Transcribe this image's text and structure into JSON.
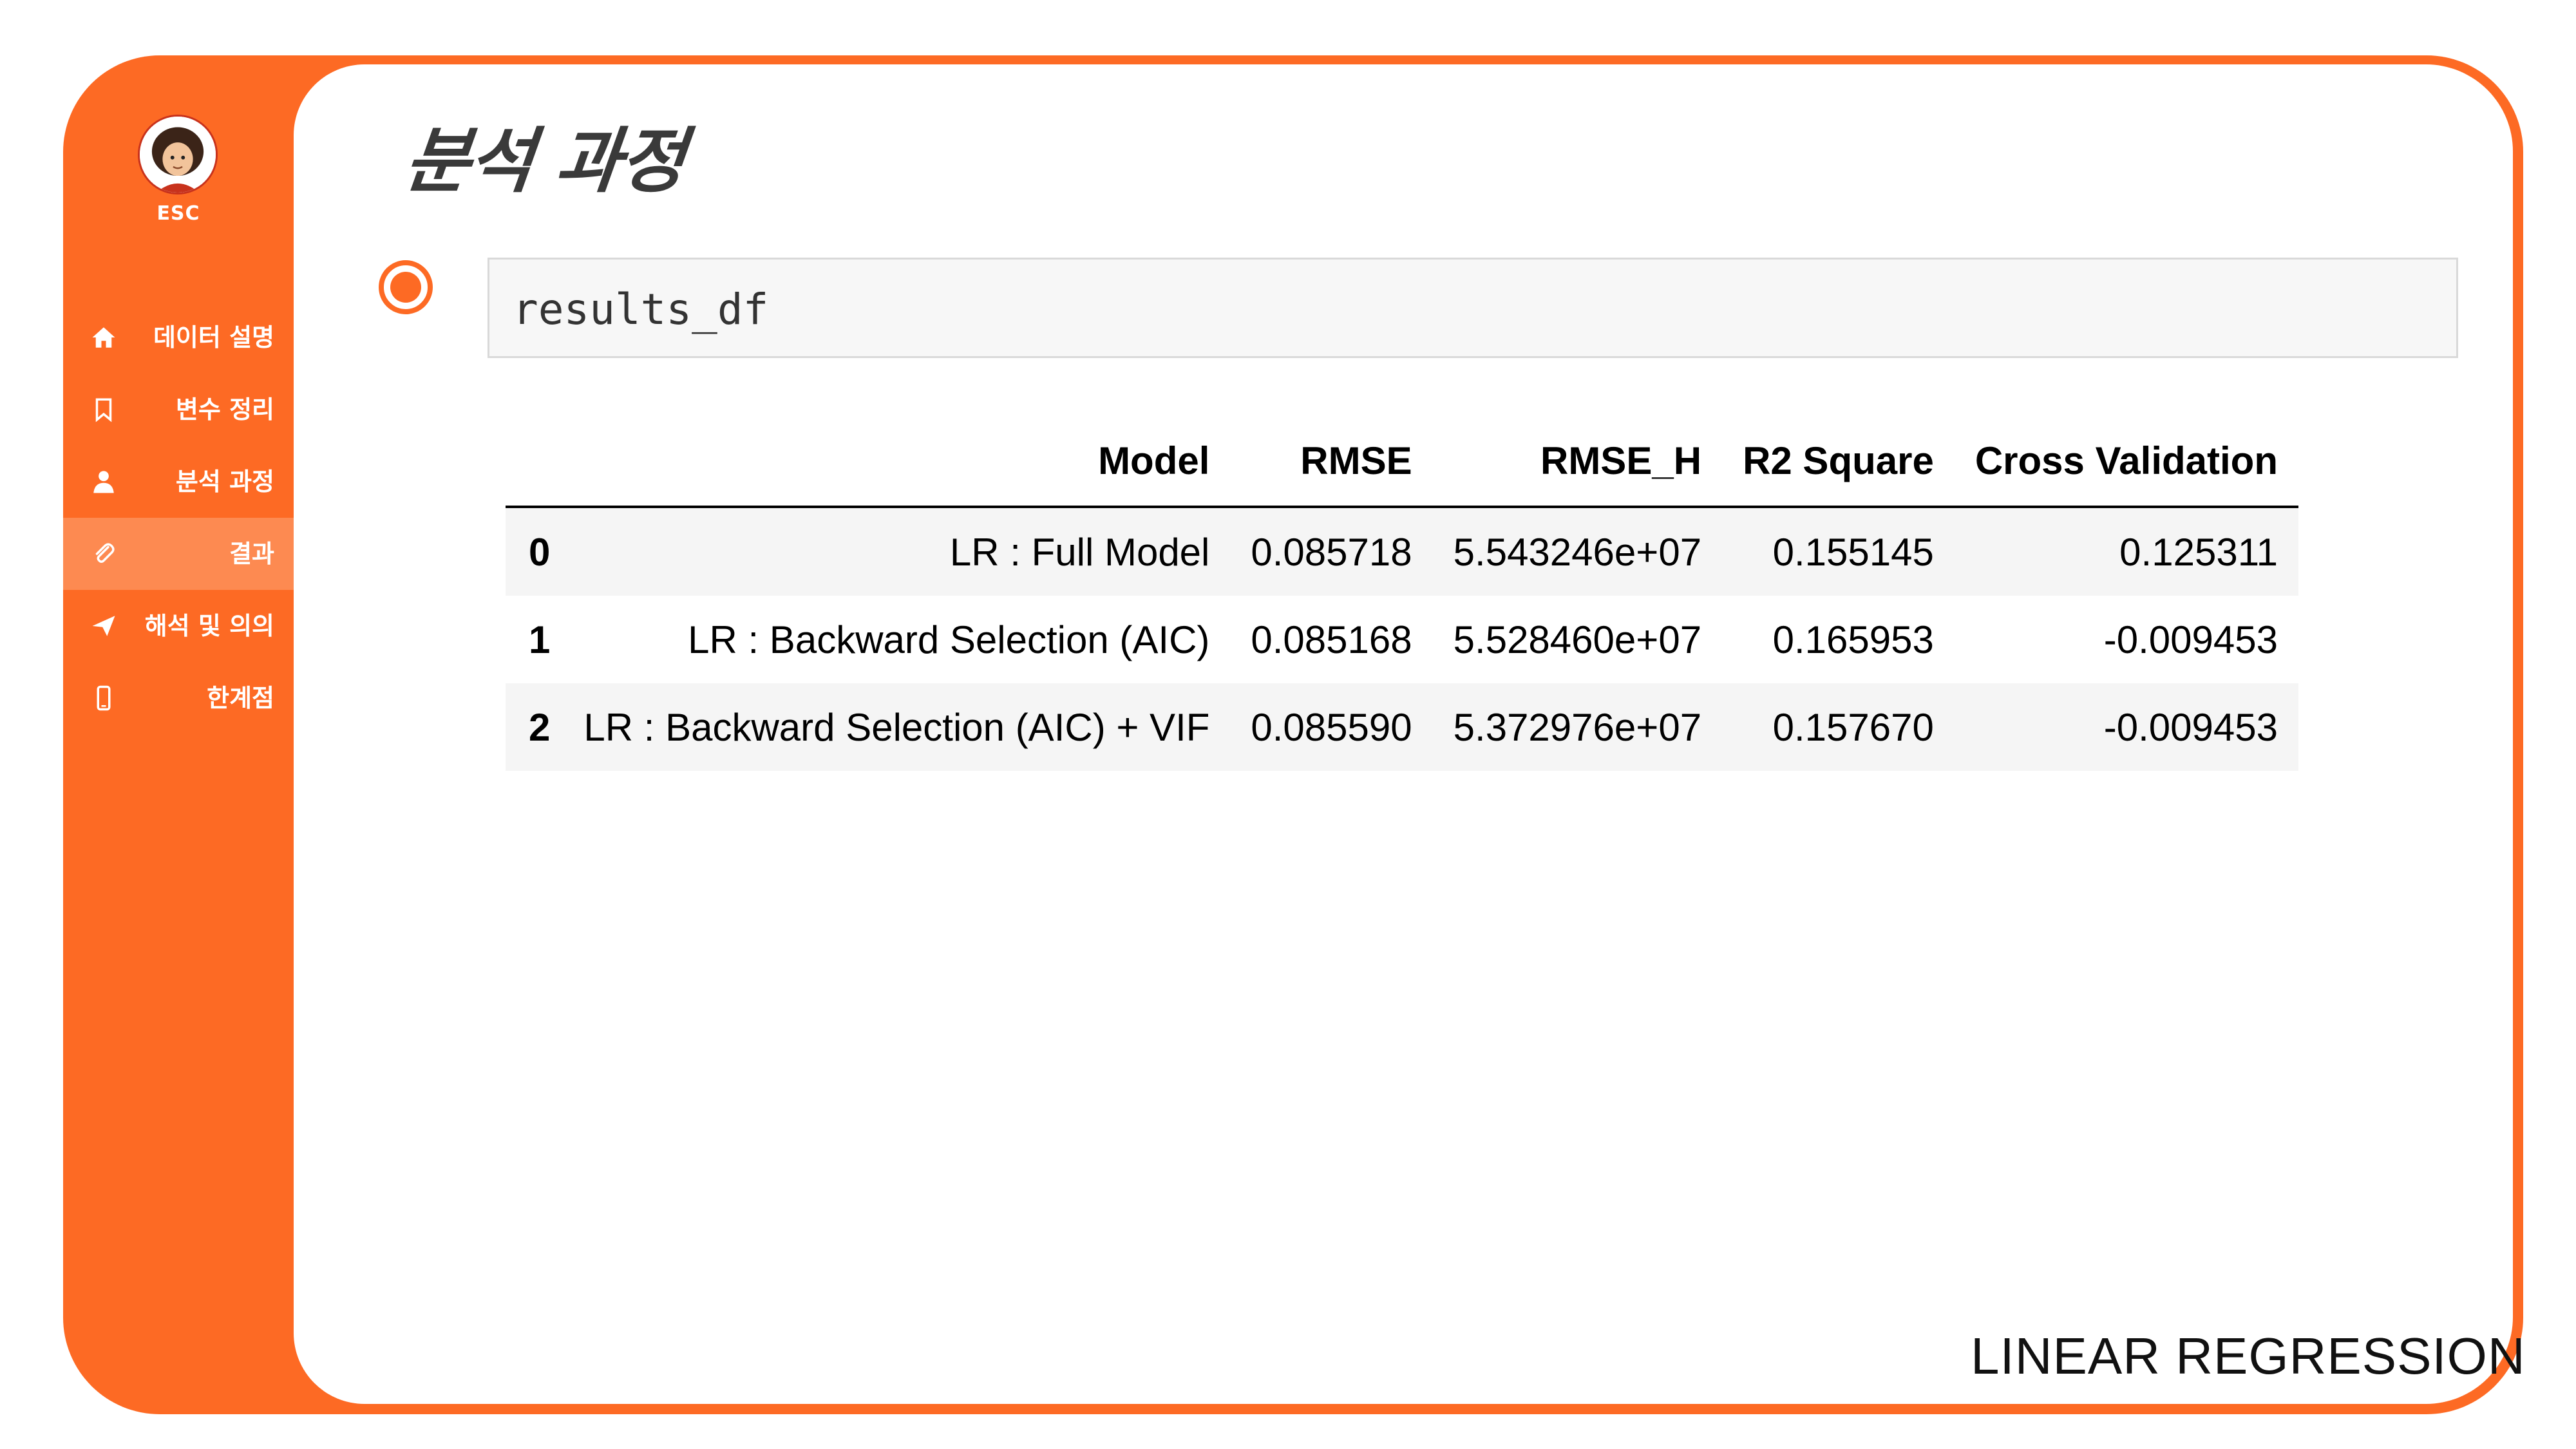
{
  "sidebar": {
    "logo_text": "ESC",
    "items": [
      {
        "label": "데이터 설명",
        "icon": "home-icon"
      },
      {
        "label": "변수 정리",
        "icon": "bookmark-icon"
      },
      {
        "label": "분석 과정",
        "icon": "user-icon"
      },
      {
        "label": "결과",
        "icon": "paperclip-icon",
        "active": true
      },
      {
        "label": "해석 및 의의",
        "icon": "send-icon"
      },
      {
        "label": "한계점",
        "icon": "phone-icon"
      }
    ]
  },
  "main": {
    "title": "분석 과정",
    "code_cell": {
      "code": "results_df"
    },
    "footer": "LINEAR REGRESSION"
  },
  "table": {
    "columns": [
      "",
      "Model",
      "RMSE",
      "RMSE_H",
      "R2 Square",
      "Cross Validation"
    ],
    "rows": [
      [
        "0",
        "LR : Full Model",
        "0.085718",
        "5.543246e+07",
        "0.155145",
        "0.125311"
      ],
      [
        "1",
        "LR : Backward Selection (AIC)",
        "0.085168",
        "5.528460e+07",
        "0.165953",
        "-0.009453"
      ],
      [
        "2",
        "LR : Backward Selection (AIC) + VIF",
        "0.085590",
        "5.372976e+07",
        "0.157670",
        "-0.009453"
      ]
    ]
  },
  "colors": {
    "accent": "#fd6a24",
    "active_item": "#fd8a51",
    "panel": "#ffffff"
  }
}
